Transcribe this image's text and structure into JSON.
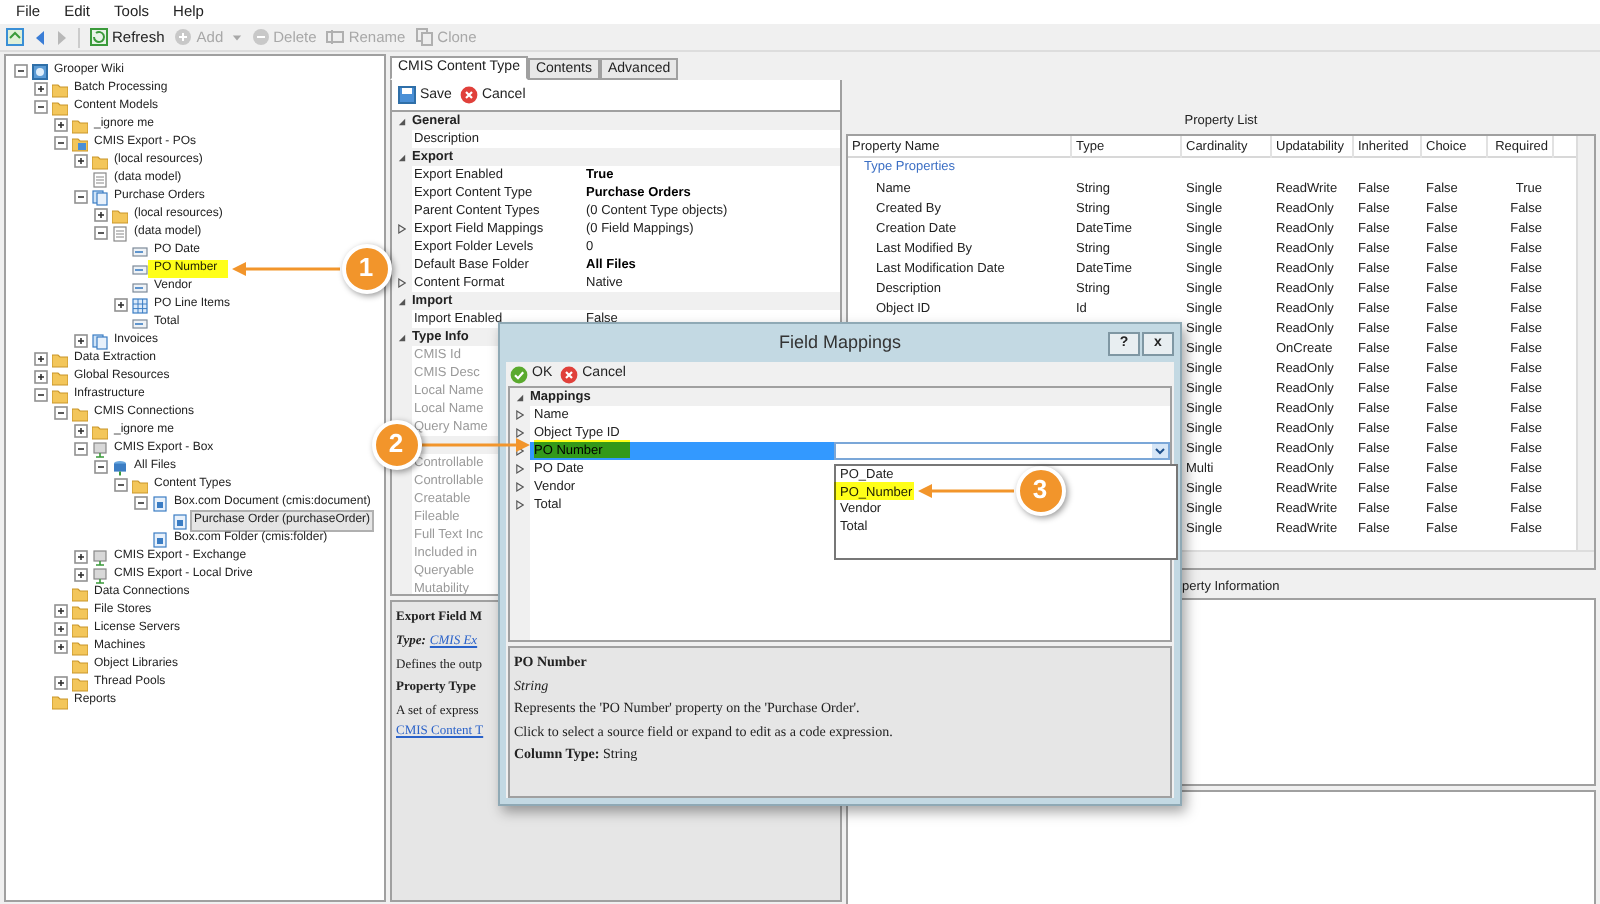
{
  "menu": [
    "File",
    "Edit",
    "Tools",
    "Help"
  ],
  "toolbar": [
    {
      "kind": "refresh",
      "label": "Refresh",
      "disabled": false
    },
    {
      "kind": "add",
      "label": "Add",
      "disabled": true
    },
    {
      "kind": "delete",
      "label": "Delete",
      "disabled": true
    },
    {
      "kind": "rename",
      "label": "Rename",
      "disabled": true
    },
    {
      "kind": "clone",
      "label": "Clone",
      "disabled": true
    }
  ],
  "tree": [
    {
      "label": "Grooper Wiki",
      "kind": "root",
      "expanded": true,
      "selected": false,
      "children": [
        {
          "label": "Batch Processing",
          "kind": "folder",
          "expanded": false,
          "selected": false
        },
        {
          "label": "Content Models",
          "kind": "folder",
          "expanded": true,
          "selected": false,
          "children": [
            {
              "label": "_ignore me",
              "kind": "folder",
              "expanded": false,
              "selected": false
            },
            {
              "label": "CMIS Export - POs",
              "kind": "content-model",
              "expanded": true,
              "selected": false,
              "children": [
                {
                  "label": "(local resources)",
                  "kind": "folder",
                  "expanded": false,
                  "selected": false
                },
                {
                  "label": "(data model)",
                  "kind": "data-model",
                  "selected": false
                },
                {
                  "label": "Purchase Orders",
                  "kind": "content-type",
                  "expanded": true,
                  "selected": false,
                  "children": [
                    {
                      "label": "(local resources)",
                      "kind": "folder",
                      "expanded": false,
                      "selected": false
                    },
                    {
                      "label": "(data model)",
                      "kind": "data-model",
                      "expanded": true,
                      "selected": false,
                      "children": [
                        {
                          "label": "PO Date",
                          "kind": "field",
                          "selected": false
                        },
                        {
                          "label": "PO Number",
                          "kind": "field",
                          "selected": false
                        },
                        {
                          "label": "Vendor",
                          "kind": "field",
                          "selected": false
                        },
                        {
                          "label": "PO Line Items",
                          "kind": "table",
                          "expanded": false,
                          "selected": false
                        },
                        {
                          "label": "Total",
                          "kind": "field",
                          "selected": false
                        }
                      ]
                    }
                  ]
                },
                {
                  "label": "Invoices",
                  "kind": "content-type",
                  "expanded": false,
                  "selected": false
                }
              ]
            }
          ]
        },
        {
          "label": "Data Extraction",
          "kind": "folder",
          "expanded": false,
          "selected": false
        },
        {
          "label": "Global Resources",
          "kind": "folder",
          "expanded": false,
          "selected": false
        },
        {
          "label": "Infrastructure",
          "kind": "folder",
          "expanded": true,
          "selected": false,
          "children": [
            {
              "label": "CMIS Connections",
              "kind": "folder",
              "expanded": true,
              "selected": false,
              "children": [
                {
                  "label": "_ignore me",
                  "kind": "folder",
                  "expanded": false,
                  "selected": false
                },
                {
                  "label": "CMIS Export - Box",
                  "kind": "connection",
                  "expanded": true,
                  "selected": false,
                  "children": [
                    {
                      "label": "All Files",
                      "kind": "repository",
                      "expanded": true,
                      "selected": false,
                      "children": [
                        {
                          "label": "Content Types",
                          "kind": "folder",
                          "expanded": true,
                          "selected": false,
                          "children": [
                            {
                              "label": "Box.com Document (cmis:document)",
                              "kind": "cmis-type",
                              "expanded": true,
                              "selected": false,
                              "children": [
                                {
                                  "label": "Purchase Order (purchaseOrder)",
                                  "kind": "cmis-type",
                                  "selected": true
                                }
                              ]
                            },
                            {
                              "label": "Box.com Folder (cmis:folder)",
                              "kind": "cmis-type",
                              "selected": false
                            }
                          ]
                        }
                      ]
                    }
                  ]
                },
                {
                  "label": "CMIS Export - Exchange",
                  "kind": "connection",
                  "expanded": false,
                  "selected": false
                },
                {
                  "label": "CMIS Export - Local Drive",
                  "kind": "connection",
                  "expanded": false,
                  "selected": false
                }
              ]
            },
            {
              "label": "Data Connections",
              "kind": "folder",
              "selected": false
            },
            {
              "label": "File Stores",
              "kind": "folder",
              "expanded": false,
              "selected": false
            },
            {
              "label": "License Servers",
              "kind": "folder",
              "expanded": false,
              "selected": false
            },
            {
              "label": "Machines",
              "kind": "folder",
              "expanded": false,
              "selected": false
            },
            {
              "label": "Object Libraries",
              "kind": "folder",
              "selected": false
            },
            {
              "label": "Thread Pools",
              "kind": "folder",
              "expanded": false,
              "selected": false
            }
          ]
        },
        {
          "label": "Reports",
          "kind": "folder",
          "selected": false
        }
      ]
    }
  ],
  "editor_tabs": [
    {
      "label": "CMIS Content Type",
      "selected": true
    },
    {
      "label": "Contents",
      "selected": false
    },
    {
      "label": "Advanced",
      "selected": false
    }
  ],
  "editor_toolbar": [
    {
      "kind": "save",
      "label": "Save"
    },
    {
      "kind": "cancel",
      "label": "Cancel"
    }
  ],
  "property_grid": [
    {
      "title": "General",
      "expanded": true,
      "rows": [
        {
          "label": "Description",
          "expandable": false,
          "disabled": false
        }
      ]
    },
    {
      "title": "Export",
      "expanded": true,
      "rows": [
        {
          "label": "Export Enabled",
          "value": "True",
          "modified": true,
          "expandable": false,
          "disabled": false
        },
        {
          "label": "Export Content Type",
          "value": "Purchase Orders",
          "modified": true,
          "expandable": false,
          "disabled": false
        },
        {
          "label": "Parent Content Types",
          "value": "(0 Content Type objects)",
          "modified": false,
          "expandable": false,
          "disabled": false
        },
        {
          "label": "Export Field Mappings",
          "value": "(0 Field Mappings)",
          "modified": false,
          "expandable": true,
          "disabled": false
        },
        {
          "label": "Export Folder Levels",
          "value": "0",
          "modified": false,
          "expandable": false,
          "disabled": false
        },
        {
          "label": "Default Base Folder",
          "value": "All Files",
          "modified": true,
          "expandable": false,
          "disabled": false
        },
        {
          "label": "Content Format",
          "value": "Native",
          "modified": false,
          "expandable": true,
          "disabled": false
        }
      ]
    },
    {
      "title": "Import",
      "expanded": true,
      "rows": [
        {
          "label": "Import Enabled",
          "value": "False",
          "modified": false,
          "expandable": false,
          "disabled": false
        }
      ]
    },
    {
      "title": "Type Info",
      "expanded": true,
      "rows": [
        {
          "label": "CMIS Id",
          "expandable": false,
          "disabled": true
        },
        {
          "label": "CMIS Desc",
          "expandable": false,
          "disabled": true
        },
        {
          "label": "Local Name",
          "expandable": false,
          "disabled": true
        },
        {
          "label": "Local Name",
          "expandable": false,
          "disabled": true
        },
        {
          "label": "Query Name",
          "expandable": false,
          "disabled": true
        }
      ]
    },
    {
      "expanded": true,
      "rows": [
        {
          "label": "Controllable",
          "expandable": false,
          "disabled": true
        },
        {
          "label": "Controllable",
          "expandable": false,
          "disabled": true
        },
        {
          "label": "Creatable",
          "expandable": false,
          "disabled": true
        },
        {
          "label": "Fileable",
          "expandable": false,
          "disabled": true
        },
        {
          "label": "Full Text Inc",
          "expandable": false,
          "disabled": true
        },
        {
          "label": "Included in",
          "expandable": false,
          "disabled": true
        },
        {
          "label": "Queryable",
          "expandable": false,
          "disabled": true
        },
        {
          "label": "Mutability",
          "expandable": false,
          "disabled": true
        }
      ]
    }
  ],
  "help_panel": [
    {
      "kind": "heading",
      "text": "Export Field M"
    },
    {
      "kind": "type",
      "label": "Type:",
      "link": "CMIS Ex"
    },
    {
      "kind": "text",
      "text": "Defines the outp"
    },
    {
      "kind": "heading",
      "text": "Property Type"
    },
    {
      "kind": "text",
      "text": "A set of express"
    },
    {
      "kind": "link",
      "text": "CMIS Content T"
    }
  ],
  "property_list": {
    "title": "Property List",
    "columns": [
      "Property Name",
      "Type",
      "Cardinality",
      "Updatability",
      "Inherited",
      "Choice",
      "Required"
    ],
    "group": "Type Properties",
    "rows": [
      {
        "name": "Name",
        "type": "String",
        "cardinality": "Single",
        "updatability": "ReadWrite",
        "inherited": "False",
        "choice": "False",
        "required": "True"
      },
      {
        "name": "Created By",
        "type": "String",
        "cardinality": "Single",
        "updatability": "ReadOnly",
        "inherited": "False",
        "choice": "False",
        "required": "False"
      },
      {
        "name": "Creation Date",
        "type": "DateTime",
        "cardinality": "Single",
        "updatability": "ReadOnly",
        "inherited": "False",
        "choice": "False",
        "required": "False"
      },
      {
        "name": "Last Modified By",
        "type": "String",
        "cardinality": "Single",
        "updatability": "ReadOnly",
        "inherited": "False",
        "choice": "False",
        "required": "False"
      },
      {
        "name": "Last Modification Date",
        "type": "DateTime",
        "cardinality": "Single",
        "updatability": "ReadOnly",
        "inherited": "False",
        "choice": "False",
        "required": "False"
      },
      {
        "name": "Description",
        "type": "String",
        "cardinality": "Single",
        "updatability": "ReadOnly",
        "inherited": "False",
        "choice": "False",
        "required": "False"
      },
      {
        "name": "Object ID",
        "type": "Id",
        "cardinality": "Single",
        "updatability": "ReadOnly",
        "inherited": "False",
        "choice": "False",
        "required": "False"
      },
      {
        "cardinality": "Single",
        "updatability": "ReadOnly",
        "inherited": "False",
        "choice": "False",
        "required": "False"
      },
      {
        "cardinality": "Single",
        "updatability": "OnCreate",
        "inherited": "False",
        "choice": "False",
        "required": "False"
      },
      {
        "cardinality": "Single",
        "updatability": "ReadOnly",
        "inherited": "False",
        "choice": "False",
        "required": "False"
      },
      {
        "cardinality": "Single",
        "updatability": "ReadOnly",
        "inherited": "False",
        "choice": "False",
        "required": "False"
      },
      {
        "cardinality": "Single",
        "updatability": "ReadOnly",
        "inherited": "False",
        "choice": "False",
        "required": "False"
      },
      {
        "cardinality": "Single",
        "updatability": "ReadOnly",
        "inherited": "False",
        "choice": "False",
        "required": "False"
      },
      {
        "cardinality": "Single",
        "updatability": "ReadOnly",
        "inherited": "False",
        "choice": "False",
        "required": "False"
      },
      {
        "cardinality": "Multi",
        "updatability": "ReadOnly",
        "inherited": "False",
        "choice": "False",
        "required": "False"
      },
      {
        "cardinality": "Single",
        "updatability": "ReadWrite",
        "inherited": "False",
        "choice": "False",
        "required": "False"
      },
      {
        "cardinality": "Single",
        "updatability": "ReadWrite",
        "inherited": "False",
        "choice": "False",
        "required": "False"
      },
      {
        "cardinality": "Single",
        "updatability": "ReadWrite",
        "inherited": "False",
        "choice": "False",
        "required": "False"
      }
    ]
  },
  "property_information": {
    "title": "perty Information"
  },
  "dialog": {
    "title": "Field Mappings",
    "title_buttons": [
      "?",
      "x"
    ],
    "toolbar": [
      {
        "kind": "ok",
        "label": "OK"
      },
      {
        "kind": "cancel",
        "label": "Cancel"
      }
    ],
    "section": {
      "title": "Mappings",
      "expanded": true
    },
    "rows": [
      {
        "label": "Name",
        "selected": false
      },
      {
        "label": "Object Type ID",
        "selected": false
      },
      {
        "label": "PO Number",
        "selected": true
      },
      {
        "label": "PO Date",
        "selected": false
      },
      {
        "label": "Vendor",
        "selected": false
      },
      {
        "label": "Total",
        "selected": false
      }
    ],
    "dropdown": {
      "expanded": true,
      "options": [
        "PO_Date",
        "PO_Number",
        "Vendor",
        "Total"
      ]
    },
    "help": {
      "title": "PO Number",
      "type": "String",
      "lines": [
        "Represents the 'PO Number' property on the 'Purchase Order'.",
        "Click to select a source field or expand to edit as a code expression."
      ],
      "footer": "**Column Type:** String"
    }
  },
  "callouts": [
    {
      "label": "1"
    },
    {
      "label": "2"
    },
    {
      "label": "3"
    }
  ]
}
